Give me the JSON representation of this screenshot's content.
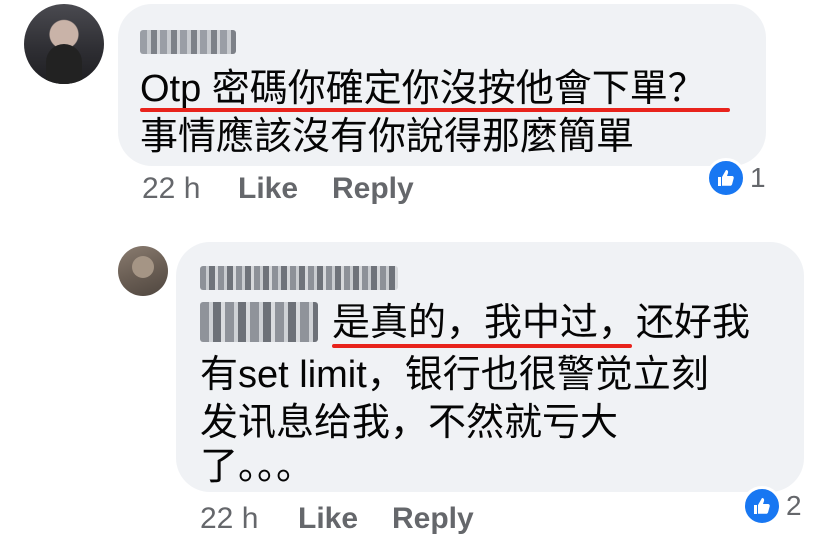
{
  "comment1": {
    "line1": "Otp 密碼你確定你沒按他會下單？",
    "line2": "事情應該沒有你說得那麼簡單",
    "time": "22 h",
    "like_label": "Like",
    "reply_label": "Reply",
    "reaction_count": "1"
  },
  "comment2": {
    "line1": "是真的，我中过，还好我",
    "line2": "有set limit，银行也很警觉立刻",
    "line3": "发讯息给我，不然就亏大",
    "line4": "了。。。",
    "time": "22 h",
    "like_label": "Like",
    "reply_label": "Reply",
    "reaction_count": "2"
  },
  "colors": {
    "bubble": "#f0f2f5",
    "underline": "#e8231c",
    "like_blue": "#1877f2",
    "meta": "#65676b"
  },
  "icons": [
    "like-thumb-icon"
  ]
}
